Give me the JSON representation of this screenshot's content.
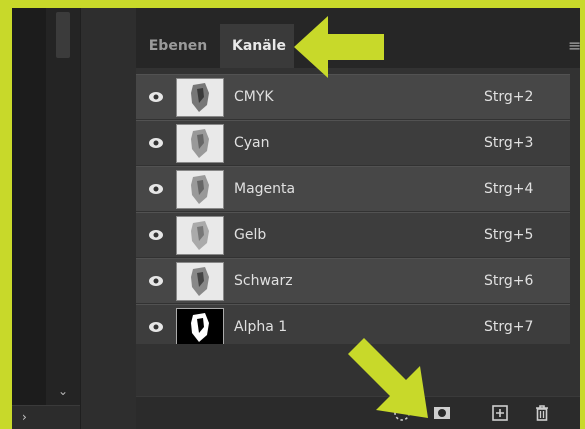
{
  "tabs": [
    {
      "label": "Ebenen"
    },
    {
      "label": "Kanäle"
    }
  ],
  "channels": [
    {
      "name": "CMYK",
      "shortcut": "Strg+2"
    },
    {
      "name": "Cyan",
      "shortcut": "Strg+3"
    },
    {
      "name": "Magenta",
      "shortcut": "Strg+4"
    },
    {
      "name": "Gelb",
      "shortcut": "Strg+5"
    },
    {
      "name": "Schwarz",
      "shortcut": "Strg+6"
    },
    {
      "name": "Alpha 1",
      "shortcut": "Strg+7"
    }
  ],
  "icons": {
    "panel_menu": "menu-icon",
    "visibility": "eye-icon",
    "load_selection": "dotted-circle-icon",
    "save_selection": "mask-icon",
    "new_channel": "plus-square-icon",
    "delete": "trash-icon",
    "collapse": "chevron-down-icon",
    "expand": "chevron-right-icon"
  },
  "colors": {
    "highlight": "#c8d92a",
    "panel_bg": "#323232",
    "row_bg": "#474747",
    "text": "#e0e0e0"
  }
}
